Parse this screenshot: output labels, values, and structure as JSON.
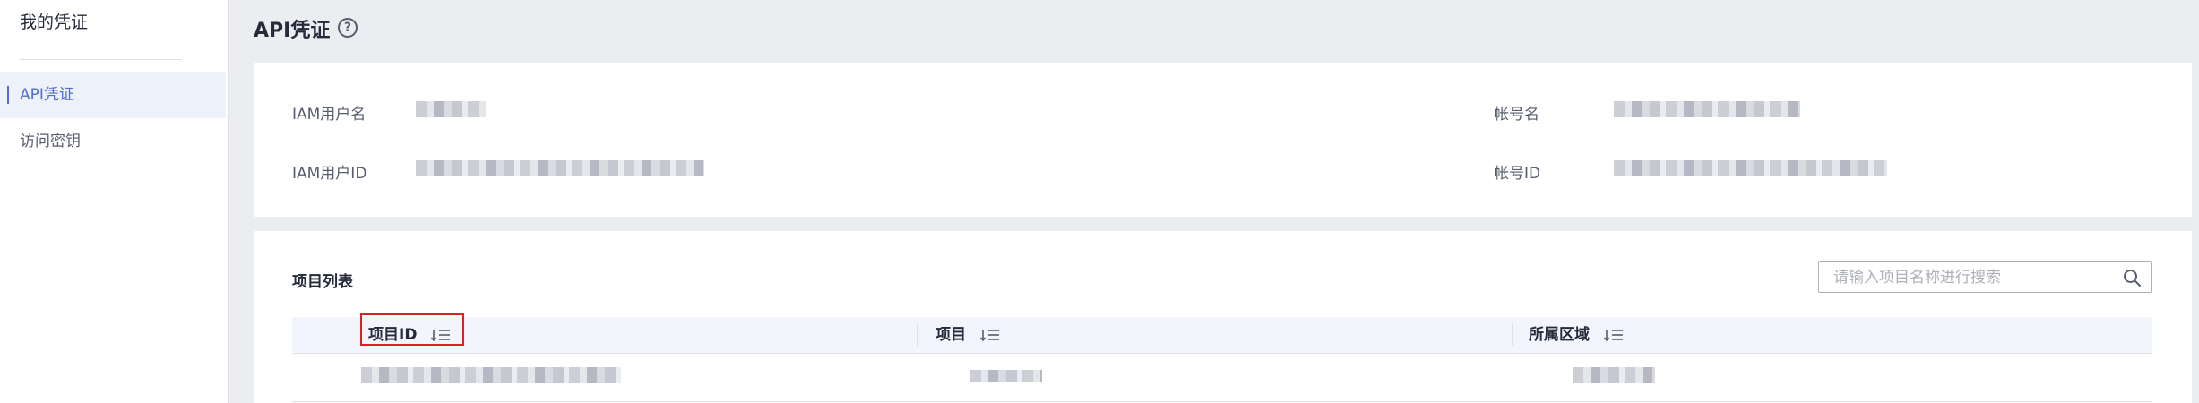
{
  "sidebar": {
    "title": "我的凭证",
    "items": [
      {
        "label": "API凭证",
        "active": true
      },
      {
        "label": "访问密钥",
        "active": false
      }
    ]
  },
  "header": {
    "title": "API凭证",
    "help_icon": "question-circle-icon"
  },
  "info": {
    "iam_username_label": "IAM用户名",
    "iam_user_id_label": "IAM用户ID",
    "account_name_label": "帐号名",
    "account_id_label": "帐号ID"
  },
  "projects": {
    "section_title": "项目列表",
    "search": {
      "placeholder": "请输入项目名称进行搜索",
      "value": ""
    },
    "columns": [
      {
        "label": "项目ID",
        "icon": "sort-icon"
      },
      {
        "label": "项目",
        "icon": "sort-icon"
      },
      {
        "label": "所属区域",
        "icon": "sort-icon"
      }
    ]
  },
  "colors": {
    "accent": "#526ecc",
    "highlight_box": "#e02020",
    "page_bg": "#ecedf1",
    "table_header_bg": "#f2f5fc"
  }
}
